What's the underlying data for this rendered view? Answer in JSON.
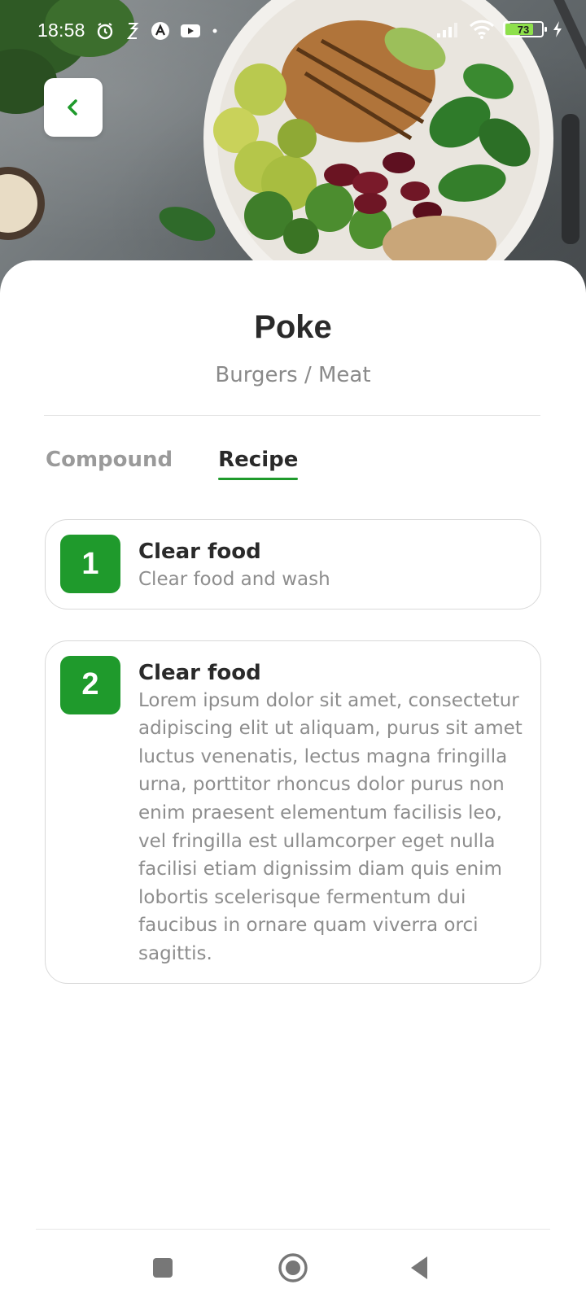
{
  "status_bar": {
    "time": "18:58",
    "battery_level": "73",
    "battery_fraction": 0.73,
    "icons": [
      "alarm-icon",
      "sim-icon",
      "app-icon",
      "youtube-icon",
      "dot-icon",
      "signal-icon",
      "wifi-icon",
      "battery-icon",
      "charging-icon"
    ]
  },
  "back_button": {
    "icon": "chevron-left-icon"
  },
  "recipe": {
    "title": "Poke",
    "subtitle": "Burgers / Meat"
  },
  "tabs": [
    {
      "label": "Compound",
      "active": false
    },
    {
      "label": "Recipe",
      "active": true
    }
  ],
  "steps": [
    {
      "number": "1",
      "title": "Clear food",
      "text": "Clear food and wash"
    },
    {
      "number": "2",
      "title": "Clear food",
      "text": "Lorem ipsum dolor sit amet, consectetur adipiscing elit ut aliquam, purus sit amet luctus venenatis, lectus magna fringilla urna, porttitor rhoncus dolor purus non enim praesent elementum facilisis leo, vel fringilla est ullamcorper eget nulla facilisi etiam dignissim diam quis enim lobortis scelerisque fermentum dui faucibus in ornare quam viverra orci sagittis."
    }
  ],
  "nav_bar": {
    "buttons": [
      "recents-icon",
      "home-icon",
      "back-icon"
    ]
  },
  "colors": {
    "accent": "#1f9a2c",
    "text": "#2a2a2a",
    "muted": "#8d8d8d",
    "border": "#d9d9d9"
  }
}
